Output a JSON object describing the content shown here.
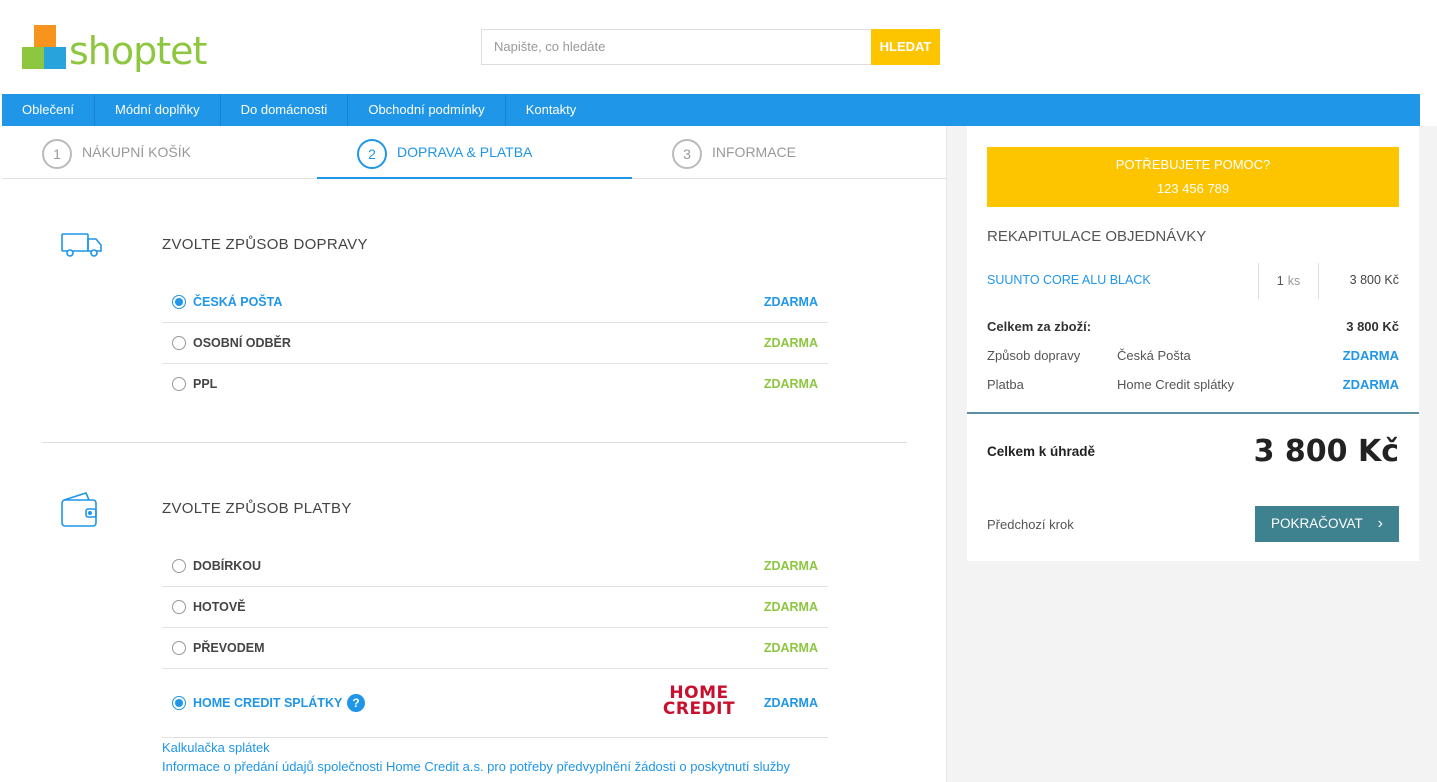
{
  "header": {
    "logo_text": "shoptet",
    "search_placeholder": "Napište, co hledáte",
    "search_button": "HLEDAT"
  },
  "nav": [
    "Oblečení",
    "Módní doplňky",
    "Do domácnosti",
    "Obchodní podmínky",
    "Kontakty"
  ],
  "steps": [
    {
      "num": "1",
      "label": "Nákupní košík"
    },
    {
      "num": "2",
      "label": "Doprava & platba"
    },
    {
      "num": "3",
      "label": "Informace"
    }
  ],
  "shipping": {
    "title": "Zvolte způsob dopravy",
    "icon": "truck-icon",
    "options": [
      {
        "label": "Česká pošta",
        "price": "ZDARMA",
        "selected": true
      },
      {
        "label": "Osobní odběr",
        "price": "ZDARMA",
        "selected": false
      },
      {
        "label": "PPL",
        "price": "ZDARMA",
        "selected": false
      }
    ]
  },
  "payment": {
    "title": "Zvolte způsob platby",
    "icon": "wallet-icon",
    "options": [
      {
        "label": "Dobírkou",
        "price": "ZDARMA",
        "selected": false
      },
      {
        "label": "Hotově",
        "price": "ZDARMA",
        "selected": false
      },
      {
        "label": "Převodem",
        "price": "ZDARMA",
        "selected": false
      },
      {
        "label": "Home Credit splátky",
        "price": "ZDARMA",
        "selected": true,
        "help": "?",
        "logo_top": "HOME",
        "logo_bottom": "CREDIT"
      }
    ],
    "links": [
      "Kalkulačka splátek",
      "Informace o předání údajů společnosti Home Credit a.s. pro potřeby předvyplnění žádosti o poskytnutí služby"
    ]
  },
  "sidebar": {
    "help_line1": "POTŘEBUJETE POMOC?",
    "help_line2": "123 456 789",
    "recap_title": "Rekapitulace objednávky",
    "item": {
      "name": "Suunto Core Alu Black",
      "qty": "1",
      "unit": "ks",
      "price": "3 800 Kč"
    },
    "subtotal_label": "Celkem za zboží:",
    "subtotal_value": "3 800 Kč",
    "shipping_label": "Způsob dopravy",
    "shipping_value": "Česká Pošta",
    "shipping_price": "ZDARMA",
    "payment_label": "Platba",
    "payment_value": "Home Credit splátky",
    "payment_price": "ZDARMA",
    "total_label": "Celkem k úhradě",
    "total_value": "3 800 Kč",
    "prev_step": "Předchozí krok",
    "continue": "Pokračovat"
  },
  "colors": {
    "accent": "#1f96e8",
    "yellow": "#fcc500",
    "green": "#8dc63f",
    "teal": "#3e8290"
  }
}
